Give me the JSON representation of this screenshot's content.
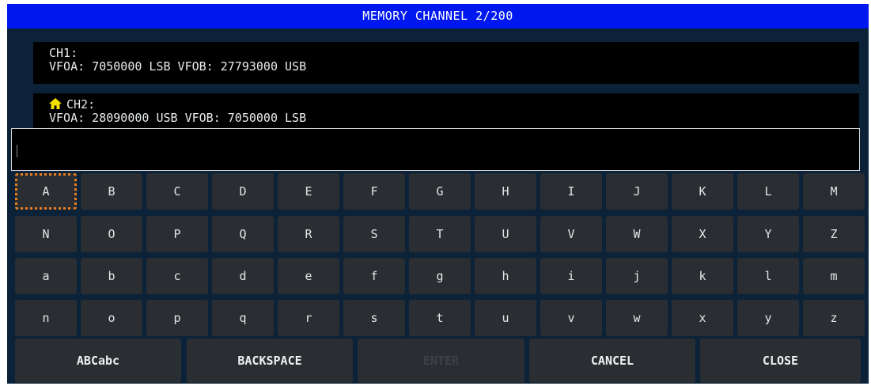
{
  "title": "MEMORY CHANNEL 2/200",
  "channels": [
    {
      "name": "CH1:",
      "detail": "VFOA: 7050000 LSB VFOB: 27793000 USB",
      "is_home": false
    },
    {
      "name": "CH2:",
      "detail": "VFOA: 28090000 USB VFOB: 7050000 LSB",
      "is_home": true
    }
  ],
  "input": {
    "value": "",
    "placeholder": ""
  },
  "keyboard": {
    "rows": [
      [
        "A",
        "B",
        "C",
        "D",
        "E",
        "F",
        "G",
        "H",
        "I",
        "J",
        "K",
        "L",
        "M"
      ],
      [
        "N",
        "O",
        "P",
        "Q",
        "R",
        "S",
        "T",
        "U",
        "V",
        "W",
        "X",
        "Y",
        "Z"
      ],
      [
        "a",
        "b",
        "c",
        "d",
        "e",
        "f",
        "g",
        "h",
        "i",
        "j",
        "k",
        "l",
        "m"
      ],
      [
        "n",
        "o",
        "p",
        "q",
        "r",
        "s",
        "t",
        "u",
        "v",
        "w",
        "x",
        "y",
        "z"
      ]
    ],
    "focused_key": "A",
    "actions": [
      "ABCabc",
      "BACKSPACE",
      "ENTER",
      "CANCEL",
      "CLOSE"
    ],
    "disabled_actions": [
      "ENTER"
    ]
  },
  "colors": {
    "title_bar": "#0018f0",
    "background": "#0b2238",
    "key": "#2a2d31",
    "focus_outline": "#e87e1e",
    "home_icon": "#f5e100"
  }
}
